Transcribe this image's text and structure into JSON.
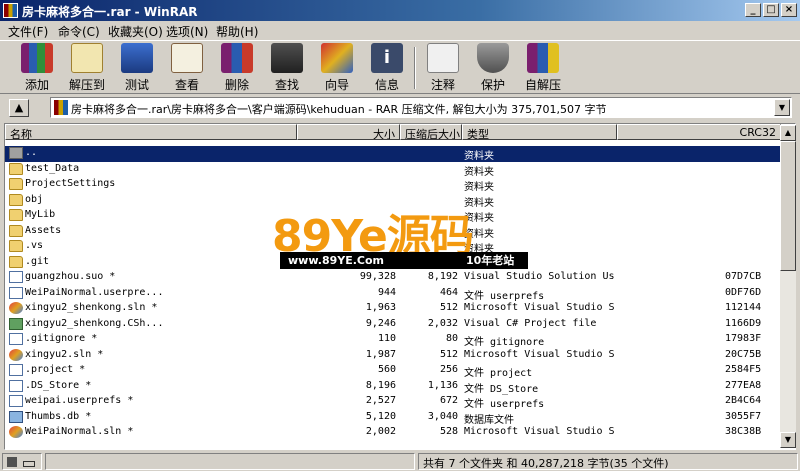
{
  "window": {
    "title": "房卡麻将多合一.rar - WinRAR"
  },
  "menu": [
    "文件(F)",
    "命令(C)",
    "收藏夹(O)",
    "选项(N)",
    "帮助(H)"
  ],
  "toolbar": [
    {
      "label": "添加",
      "icon": "add-archive-icon"
    },
    {
      "label": "解压到",
      "icon": "extract-to-icon"
    },
    {
      "label": "测试",
      "icon": "test-icon"
    },
    {
      "label": "查看",
      "icon": "view-icon"
    },
    {
      "label": "删除",
      "icon": "delete-icon"
    },
    {
      "label": "查找",
      "icon": "find-icon"
    },
    {
      "label": "向导",
      "icon": "wizard-icon"
    },
    {
      "label": "信息",
      "icon": "info-icon"
    },
    {
      "label": "注释",
      "icon": "comment-icon"
    },
    {
      "label": "保护",
      "icon": "protect-icon"
    },
    {
      "label": "自解压",
      "icon": "sfx-icon"
    }
  ],
  "address": {
    "path": "房卡麻将多合一.rar\\房卡麻将多合一\\客户端源码\\kehuduan - RAR 压缩文件, 解包大小为 375,701,507 字节"
  },
  "columns": [
    "名称",
    "大小",
    "压缩后大小",
    "类型",
    "CRC32"
  ],
  "files": [
    {
      "name": "..",
      "size": "",
      "packed": "",
      "type": "资料夹",
      "crc": "",
      "icon": "up-folder-icon",
      "kind": "upfolder",
      "selected": true
    },
    {
      "name": "test_Data",
      "size": "",
      "packed": "",
      "type": "资料夹",
      "crc": "",
      "icon": "folder-icon",
      "kind": "folder"
    },
    {
      "name": "ProjectSettings",
      "size": "",
      "packed": "",
      "type": "资料夹",
      "crc": "",
      "icon": "folder-icon",
      "kind": "folder"
    },
    {
      "name": "obj",
      "size": "",
      "packed": "",
      "type": "资料夹",
      "crc": "",
      "icon": "folder-icon",
      "kind": "folder"
    },
    {
      "name": "MyLib",
      "size": "",
      "packed": "",
      "type": "资料夹",
      "crc": "",
      "icon": "folder-icon",
      "kind": "folder"
    },
    {
      "name": "Assets",
      "size": "",
      "packed": "",
      "type": "资料夹",
      "crc": "",
      "icon": "folder-icon",
      "kind": "folder"
    },
    {
      "name": ".vs",
      "size": "",
      "packed": "",
      "type": "资料夹",
      "crc": "",
      "icon": "folder-icon",
      "kind": "folder"
    },
    {
      "name": ".git",
      "size": "",
      "packed": "",
      "type": "资料夹",
      "crc": "",
      "icon": "folder-icon",
      "kind": "folder"
    },
    {
      "name": "guangzhou.suo *",
      "size": "99,328",
      "packed": "8,192",
      "type": "Visual Studio Solution Us...",
      "crc": "07D7CB",
      "icon": "suo-file-icon",
      "kind": "doc"
    },
    {
      "name": "WeiPaiNormal.userpre...",
      "size": "944",
      "packed": "464",
      "type": "文件 userprefs",
      "crc": "0DF76D",
      "icon": "file-icon",
      "kind": "doc"
    },
    {
      "name": "xingyu2_shenkong.sln *",
      "size": "1,963",
      "packed": "512",
      "type": "Microsoft Visual Studio S...",
      "crc": "112144",
      "icon": "vs-solution-icon",
      "kind": "vs"
    },
    {
      "name": "xingyu2_shenkong.CSh...",
      "size": "9,246",
      "packed": "2,032",
      "type": "Visual C# Project file",
      "crc": "1166D9",
      "icon": "csharp-project-icon",
      "kind": "cs"
    },
    {
      "name": ".gitignore *",
      "size": "110",
      "packed": "80",
      "type": "文件 gitignore",
      "crc": "17983F",
      "icon": "file-icon",
      "kind": "doc"
    },
    {
      "name": "xingyu2.sln *",
      "size": "1,987",
      "packed": "512",
      "type": "Microsoft Visual Studio S...",
      "crc": "20C75B",
      "icon": "vs-solution-icon",
      "kind": "vs"
    },
    {
      "name": ".project *",
      "size": "560",
      "packed": "256",
      "type": "文件 project",
      "crc": "2584F5",
      "icon": "file-icon",
      "kind": "doc"
    },
    {
      "name": ".DS_Store *",
      "size": "8,196",
      "packed": "1,136",
      "type": "文件 DS_Store",
      "crc": "277EA8",
      "icon": "file-icon",
      "kind": "doc"
    },
    {
      "name": "weipai.userprefs *",
      "size": "2,527",
      "packed": "672",
      "type": "文件 userprefs",
      "crc": "2B4C64",
      "icon": "file-icon",
      "kind": "doc"
    },
    {
      "name": "Thumbs.db *",
      "size": "5,120",
      "packed": "3,040",
      "type": "数据库文件",
      "crc": "3055F7",
      "icon": "database-file-icon",
      "kind": "img"
    },
    {
      "name": "WeiPaiNormal.sln *",
      "size": "2,002",
      "packed": "528",
      "type": "Microsoft Visual Studio S...",
      "crc": "38C38B",
      "icon": "vs-solution-icon",
      "kind": "vs"
    }
  ],
  "watermark": {
    "brand": "89Ye源码",
    "url": "www.89YE.Com",
    "tag": "10年老站"
  },
  "status": {
    "right": "共有 7 个文件夹 和 40,287,218 字节(35 个文件)"
  }
}
